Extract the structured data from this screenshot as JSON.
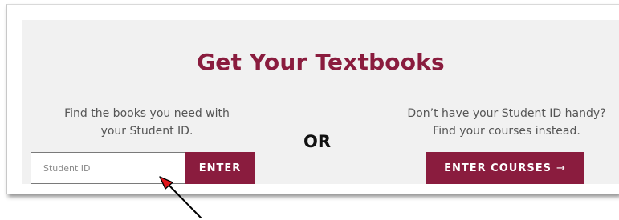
{
  "textbooks": {
    "title": "Get Your Textbooks",
    "student_id_prompt": {
      "line1": "Find the books you need with",
      "line2": "your Student ID."
    },
    "separator": "OR",
    "no_id_prompt": {
      "line1": "Don’t have your Student ID handy?",
      "line2": "Find your courses instead."
    },
    "student_id_input": {
      "placeholder": "Student ID",
      "value": ""
    },
    "enter_button": "ENTER",
    "courses_button": "ENTER COURSES",
    "courses_button_icon": "arrow-right-icon"
  },
  "colors": {
    "brand": "#8a1c3e",
    "panel_background": "#f1f1f1",
    "body_text": "#555555",
    "annotation_arrow_head": "#e0161a"
  },
  "annotation": {
    "icon": "pointer-arrow-icon",
    "points_to": "student-id-input"
  }
}
